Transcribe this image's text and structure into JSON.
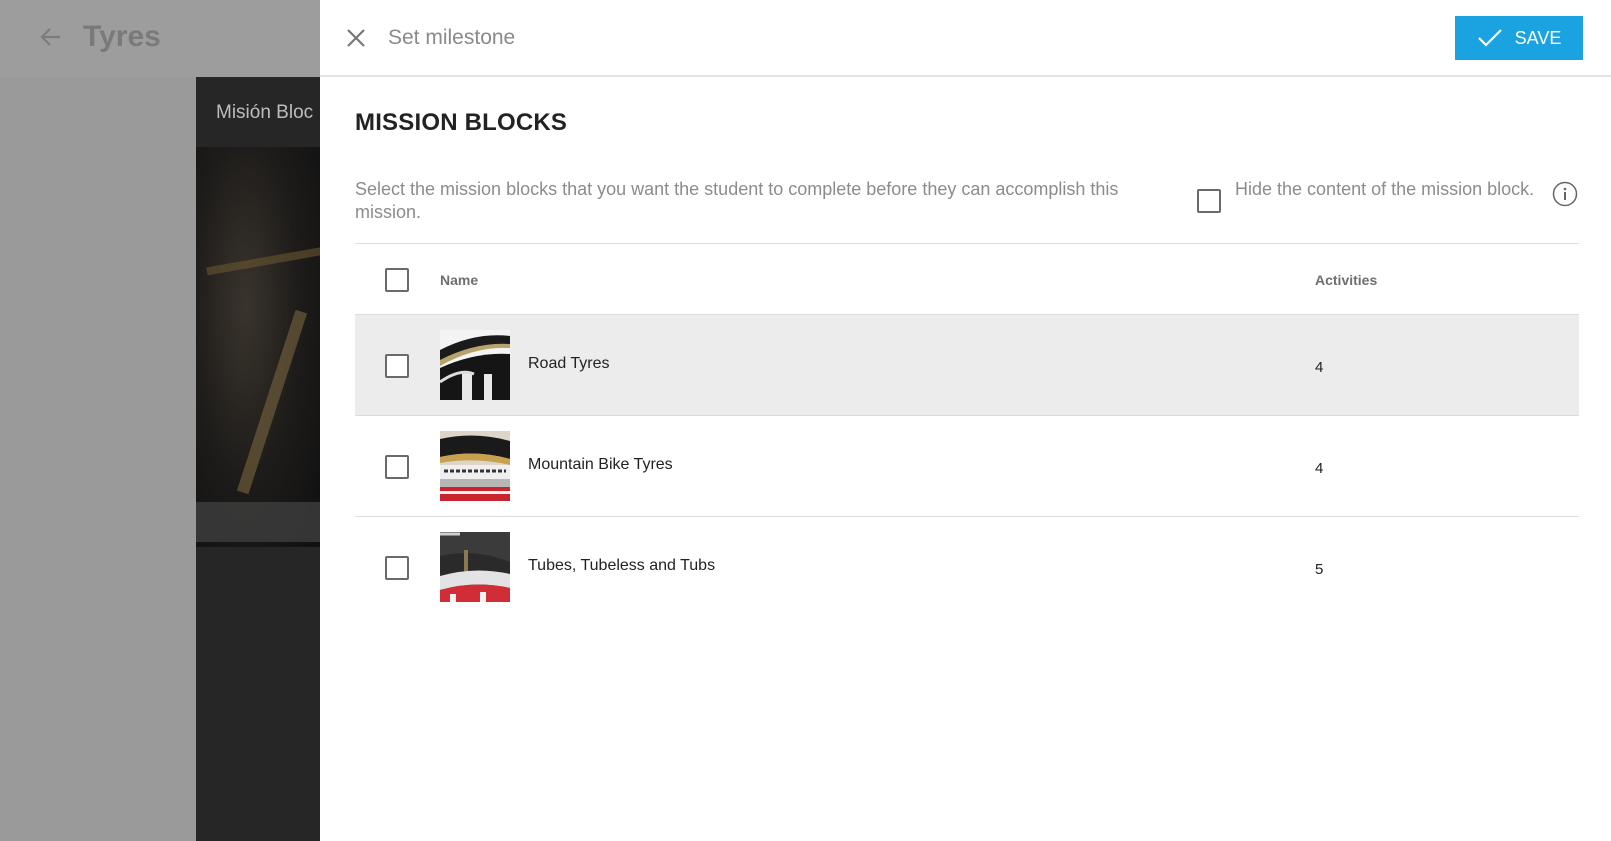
{
  "background": {
    "page_title": "Tyres",
    "dialog_title": "Misión Bloc"
  },
  "header": {
    "title": "Set milestone",
    "save_label": "SAVE",
    "icons": {
      "close": "close-icon",
      "save": "check-icon"
    }
  },
  "section": {
    "title": "MISSION BLOCKS",
    "description": "Select the mission blocks that you want the student to complete before they can accomplish this mission.",
    "hide_label": "Hide the content of the mission block.",
    "hide_checked": false,
    "info_icon": "info-icon"
  },
  "table": {
    "columns": {
      "name": "Name",
      "activities": "Activities"
    },
    "rows": [
      {
        "name": "Road Tyres",
        "activities": "4",
        "checked": false,
        "highlighted": true
      },
      {
        "name": "Mountain Bike Tyres",
        "activities": "4",
        "checked": false,
        "highlighted": false
      },
      {
        "name": "Tubes, Tubeless and Tubs",
        "activities": "5",
        "checked": false,
        "highlighted": false
      }
    ]
  },
  "colors": {
    "accent": "#1aa3e0",
    "overlay": "#9a9a9a",
    "row_highlight": "#ececec"
  }
}
